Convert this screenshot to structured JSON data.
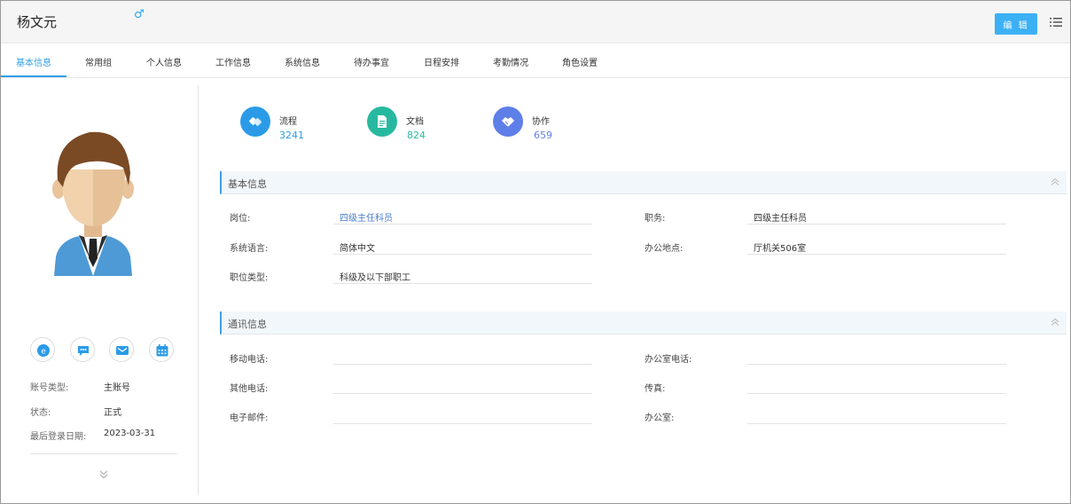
{
  "header": {
    "user_name": "杨文元",
    "gender_symbol": "♂",
    "edit_label": "编 辑"
  },
  "tabs": [
    {
      "label": "基本信息",
      "active": true
    },
    {
      "label": "常用组"
    },
    {
      "label": "个人信息"
    },
    {
      "label": "工作信息"
    },
    {
      "label": "系统信息"
    },
    {
      "label": "待办事宜"
    },
    {
      "label": "日程安排"
    },
    {
      "label": "考勤情况"
    },
    {
      "label": "角色设置"
    }
  ],
  "left": {
    "account_type_label": "账号类型:",
    "account_type_value": "主账号",
    "status_label": "状态:",
    "status_value": "正式",
    "last_login_label": "最后登录日期:",
    "last_login_value": "2023-03-31",
    "contact_buttons": [
      "emessage-icon",
      "chat-icon",
      "mail-icon",
      "calendar-icon"
    ]
  },
  "stats": [
    {
      "label": "流程",
      "value": "3241",
      "color": "#2b9be8"
    },
    {
      "label": "文档",
      "value": "824",
      "color": "#27b9a0"
    },
    {
      "label": "协作",
      "value": "659",
      "color": "#5f7fe8"
    }
  ],
  "basic_info": {
    "title": "基本信息",
    "fields": {
      "position_label": "岗位:",
      "position_value": "四级主任科员",
      "duty_label": "职务:",
      "duty_value": "四级主任科员",
      "language_label": "系统语言:",
      "language_value": "简体中文",
      "office_location_label": "办公地点:",
      "office_location_value": "厅机关506室",
      "job_type_label": "职位类型:",
      "job_type_value": "科级及以下部职工"
    }
  },
  "contact_info": {
    "title": "通讯信息",
    "fields": {
      "mobile_label": "移动电话:",
      "office_phone_label": "办公室电话:",
      "other_phone_label": "其他电话:",
      "fax_label": "传真:",
      "email_label": "电子邮件:",
      "office_label": "办公室:"
    }
  },
  "colors": {
    "accent": "#2f9fe8",
    "edit_button": "#3cb0f4"
  }
}
